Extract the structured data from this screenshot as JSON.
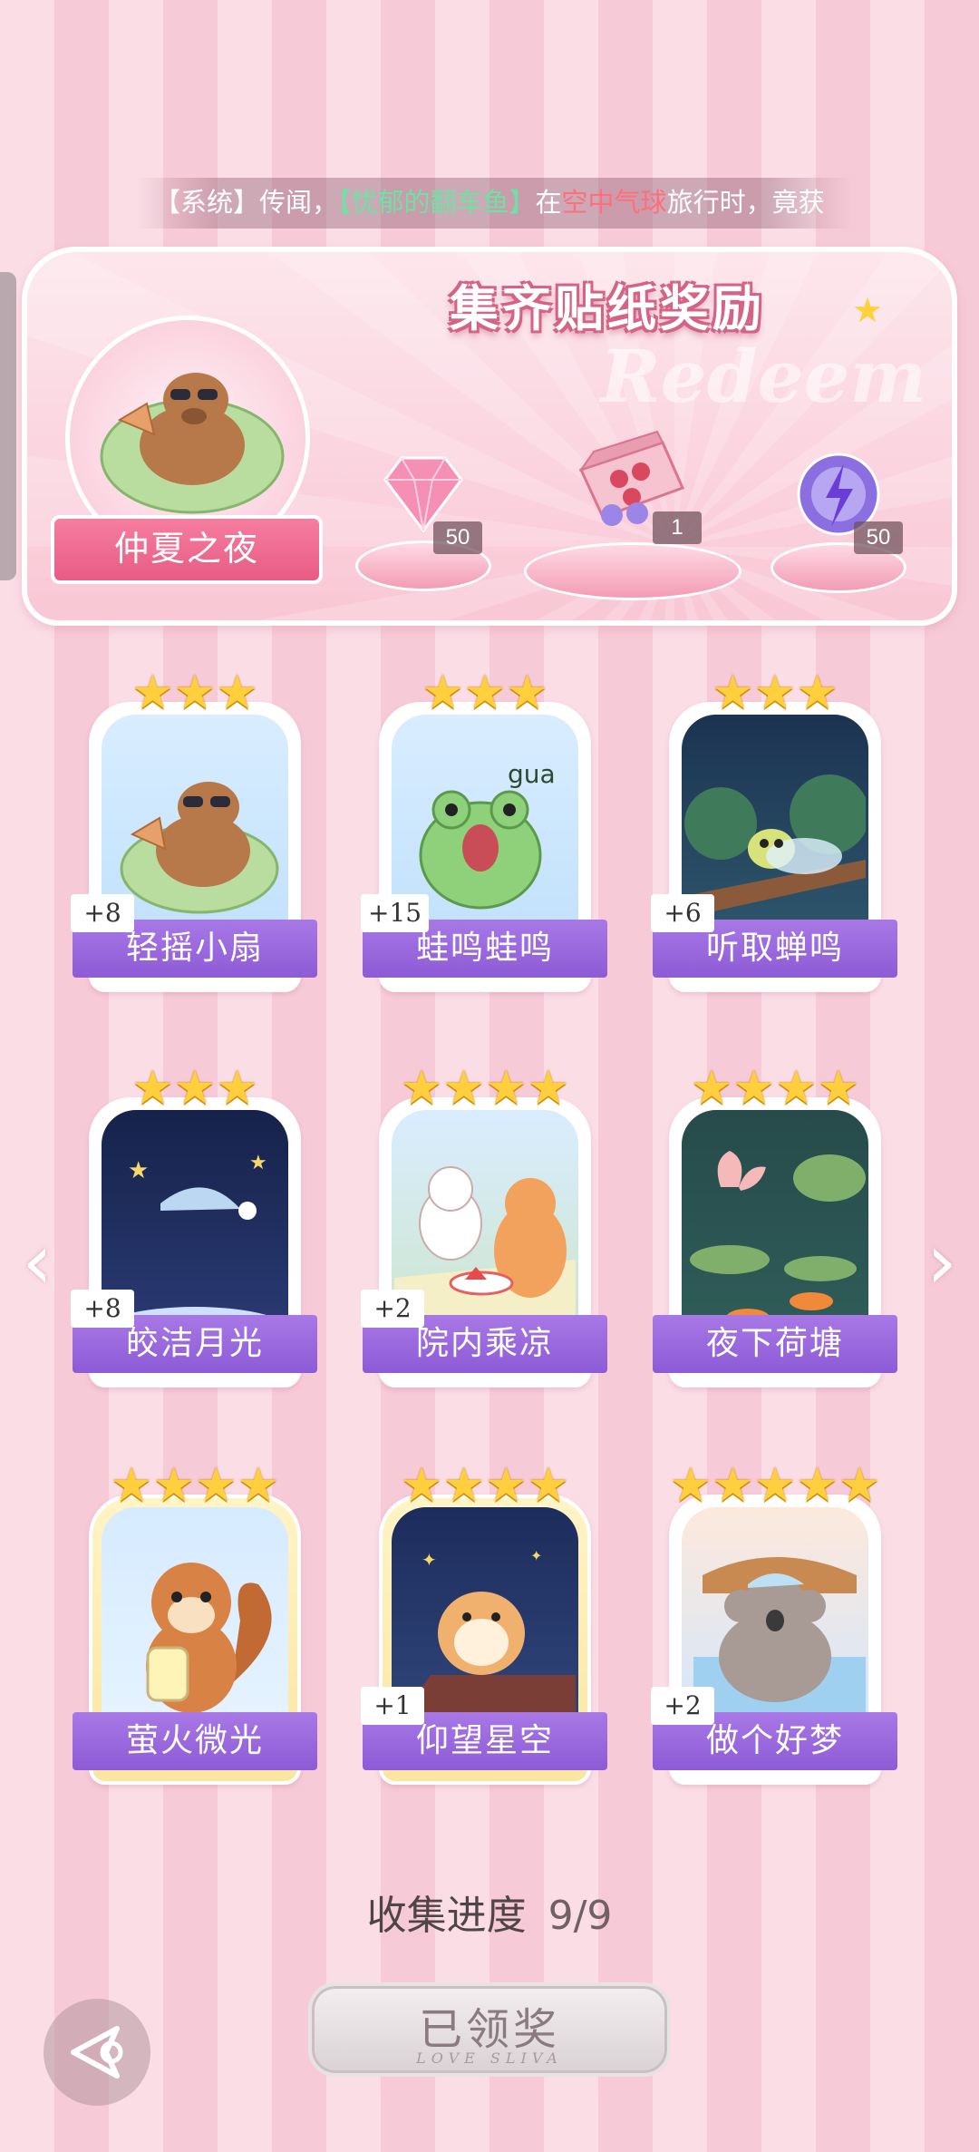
{
  "ticker": {
    "prefix": "【系统】传闻，",
    "name": "【忧郁的翻车鱼】",
    "mid": "在",
    "place": "空中气球",
    "suffix": "旅行时，竟获"
  },
  "banner": {
    "title": "集齐贴纸奖励",
    "watermark": "Redeem",
    "avatar_name": "仲夏之夜",
    "rewards": [
      {
        "icon": "pink-diamond-icon",
        "count": "50"
      },
      {
        "icon": "gift-box-icon",
        "count": "1"
      },
      {
        "icon": "energy-orb-icon",
        "count": "50"
      }
    ]
  },
  "cards": [
    {
      "label": "轻摇小扇",
      "stars": "★★★",
      "plus": "+8",
      "icon": "capybara-fan-icon"
    },
    {
      "label": "蛙鸣蛙鸣",
      "stars": "★★★",
      "plus": "+15",
      "icon": "frog-icon",
      "art_text": "gua"
    },
    {
      "label": "听取蝉鸣",
      "stars": "★★★",
      "plus": "+6",
      "icon": "cicada-icon"
    },
    {
      "label": "皎洁月光",
      "stars": "★★★",
      "plus": "+8",
      "icon": "moon-icon"
    },
    {
      "label": "院内乘凉",
      "stars": "★★★★",
      "plus": "+2",
      "icon": "cats-picnic-icon"
    },
    {
      "label": "夜下荷塘",
      "stars": "★★★★",
      "plus": "",
      "icon": "lotus-pond-icon"
    },
    {
      "label": "萤火微光",
      "stars": "★★★★",
      "plus": "",
      "icon": "squirrel-firefly-icon"
    },
    {
      "label": "仰望星空",
      "stars": "★★★★",
      "plus": "+1",
      "icon": "hamster-roof-icon"
    },
    {
      "label": "做个好梦",
      "stars": "★★★★★",
      "plus": "+2",
      "icon": "koala-sleep-icon"
    }
  ],
  "progress": {
    "label": "收集进度",
    "value": "9/9"
  },
  "claim": {
    "label": "已领奖",
    "sub": "LOVE SLIVA"
  },
  "colors": {
    "accent_pink": "#e85b85",
    "label_purple": "#8d5bd6",
    "star_gold": "#ffcf3d"
  }
}
